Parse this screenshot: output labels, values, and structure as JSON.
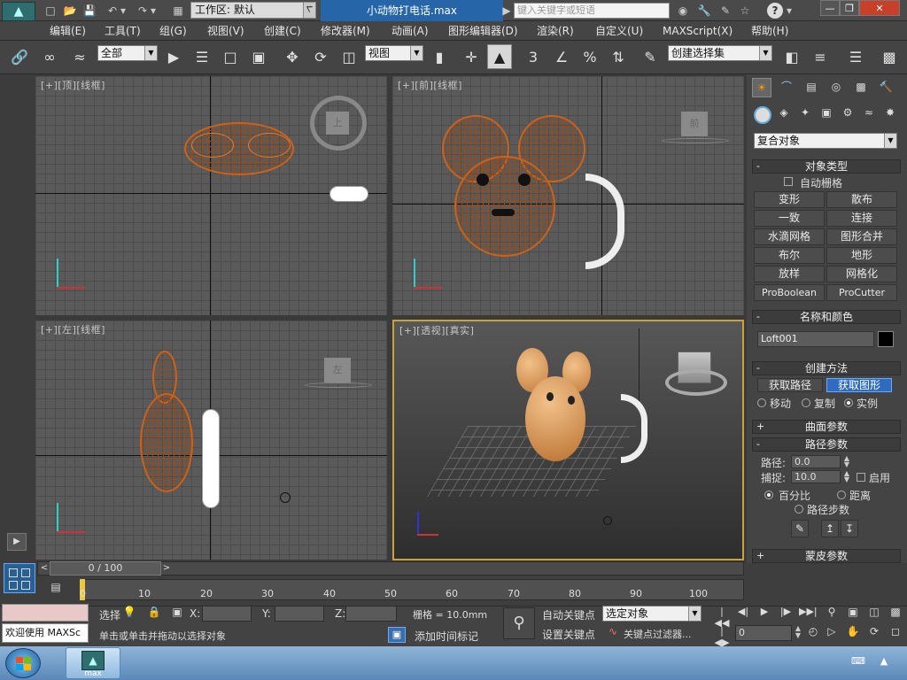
{
  "title_bar": {
    "workspace": "工作区: 默认",
    "document": "小动物打电话.max",
    "search_placeholder": "键入关键字或短语"
  },
  "menu": [
    "编辑(E)",
    "工具(T)",
    "组(G)",
    "视图(V)",
    "创建(C)",
    "修改器(M)",
    "动画(A)",
    "图形编辑器(D)",
    "渲染(R)",
    "自定义(U)",
    "MAXScript(X)",
    "帮助(H)"
  ],
  "toolbar": {
    "selection_filter": "全部",
    "reference_coord": "视图",
    "named_selection": "创建选择集",
    "snaps_label": "3"
  },
  "viewports": {
    "top": "[+][顶][线框]",
    "front": "[+][前][线框]",
    "left": "[+][左][线框]",
    "perspective": "[+][透视][真实]",
    "front_cube": "前",
    "left_cube": "左",
    "top_cube": "上"
  },
  "command_panel": {
    "category": "复合对象",
    "object_type": {
      "title": "对象类型",
      "auto_grid": "自动栅格",
      "buttons": [
        "变形",
        "散布",
        "一致",
        "连接",
        "水滴网格",
        "图形合并",
        "布尔",
        "地形",
        "放样",
        "网格化",
        "ProBoolean",
        "ProCutter"
      ]
    },
    "name_color": {
      "title": "名称和颜色",
      "name": "Loft001",
      "color": "#000000"
    },
    "creation_method": {
      "title": "创建方法",
      "get_path": "获取路径",
      "get_shape": "获取图形",
      "move": "移动",
      "copy": "复制",
      "instance": "实例"
    },
    "surface_params": "曲面参数",
    "path_params": {
      "title": "路径参数",
      "path_label": "路径:",
      "path_value": "0.0",
      "snap_label": "捕捉:",
      "snap_value": "10.0",
      "enable": "启用",
      "percentage": "百分比",
      "distance": "距离",
      "path_steps": "路径步数"
    },
    "skin_params": "蒙皮参数"
  },
  "timeline": {
    "frame": "0 / 100",
    "ticks": [
      "0",
      "10",
      "20",
      "30",
      "40",
      "50",
      "60",
      "70",
      "80",
      "90",
      "100"
    ]
  },
  "status": {
    "welcome": "欢迎使用 MAXSc",
    "select_label": "选择",
    "x_label": "X:",
    "y_label": "Y:",
    "z_label": "Z:",
    "grid": "栅格 = 10.0mm",
    "prompt": "单击或单击并拖动以选择对象",
    "add_time_tag": "添加时间标记",
    "auto_key": "自动关键点",
    "set_key": "设置关键点",
    "selected_object": "选定对象",
    "key_filters": "关键点过滤器...",
    "frame_field": "0"
  },
  "taskbar": {
    "app_label": "max"
  }
}
